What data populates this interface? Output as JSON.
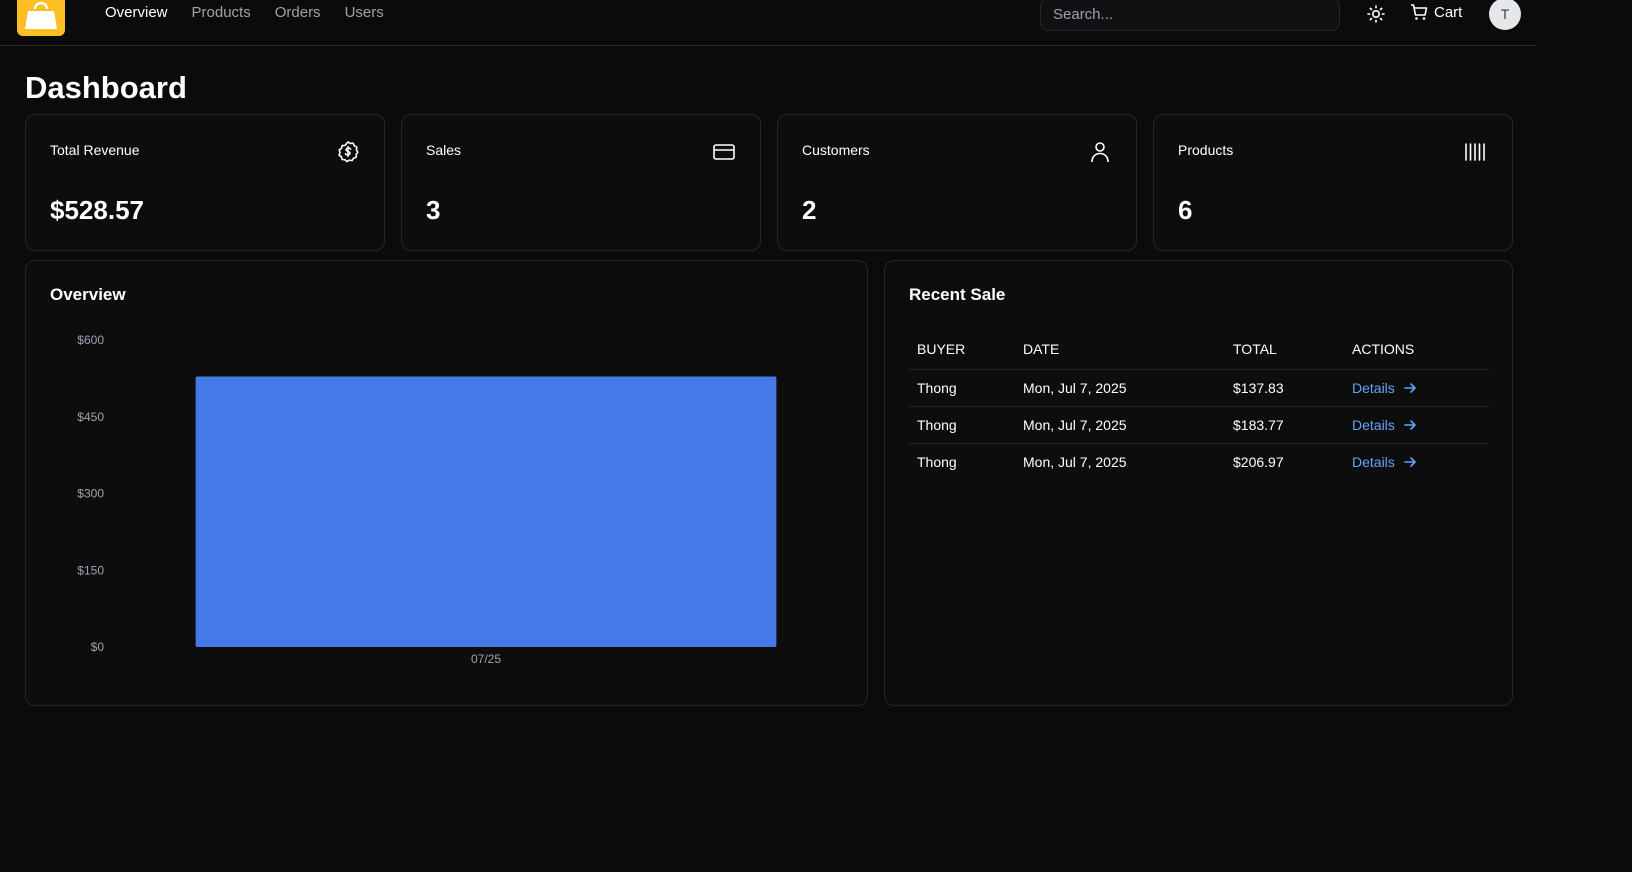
{
  "nav": {
    "items": [
      {
        "label": "Overview",
        "active": true
      },
      {
        "label": "Products",
        "active": false
      },
      {
        "label": "Orders",
        "active": false
      },
      {
        "label": "Users",
        "active": false
      }
    ]
  },
  "search": {
    "placeholder": "Search..."
  },
  "header": {
    "cart_label": "Cart",
    "avatar_initial": "T"
  },
  "page": {
    "title": "Dashboard"
  },
  "stats": [
    {
      "label": "Total Revenue",
      "value": "$528.57",
      "icon": "dollar-badge-icon"
    },
    {
      "label": "Sales",
      "value": "3",
      "icon": "credit-card-icon"
    },
    {
      "label": "Customers",
      "value": "2",
      "icon": "user-icon"
    },
    {
      "label": "Products",
      "value": "6",
      "icon": "barcode-icon"
    }
  ],
  "overview": {
    "title": "Overview"
  },
  "chart_data": {
    "type": "bar",
    "title": "",
    "categories": [
      "07/25"
    ],
    "values": [
      528.57
    ],
    "ylim": [
      0,
      600
    ],
    "yticks": [
      0,
      150,
      300,
      450,
      600
    ],
    "ytick_labels": [
      "$0",
      "$150",
      "$300",
      "$450",
      "$600"
    ],
    "xlabel": "",
    "ylabel": "",
    "grid": false,
    "bar_color": "#4579e8"
  },
  "recent_sale": {
    "title": "Recent Sale",
    "columns": [
      "BUYER",
      "DATE",
      "TOTAL",
      "ACTIONS"
    ],
    "rows": [
      {
        "buyer": "Thong",
        "date": "Mon, Jul 7, 2025",
        "total": "$137.83",
        "action": "Details"
      },
      {
        "buyer": "Thong",
        "date": "Mon, Jul 7, 2025",
        "total": "$183.77",
        "action": "Details"
      },
      {
        "buyer": "Thong",
        "date": "Mon, Jul 7, 2025",
        "total": "$206.97",
        "action": "Details"
      }
    ]
  },
  "colors": {
    "background": "#0b0b0c",
    "brand": "#fbbf24",
    "accent_link": "#60a5fa",
    "bar": "#4579e8"
  }
}
